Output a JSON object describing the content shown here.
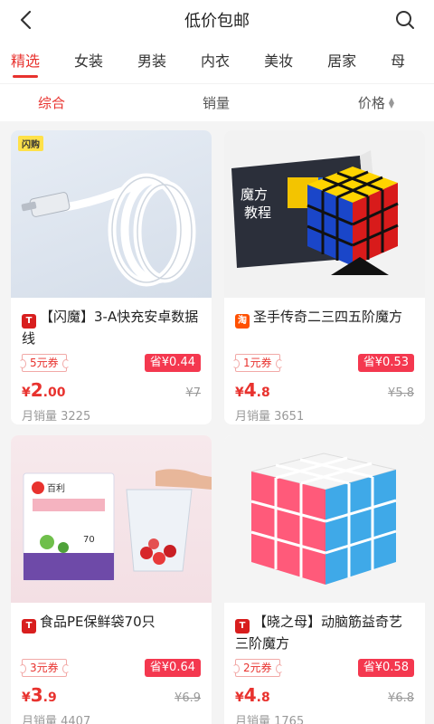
{
  "header": {
    "title": "低价包邮",
    "back_icon": "back-arrow-icon",
    "search_icon": "search-icon"
  },
  "categories": [
    "精选",
    "女装",
    "男装",
    "内衣",
    "美妆",
    "居家",
    "母"
  ],
  "sort": {
    "overall": "综合",
    "sales": "销量",
    "price": "价格"
  },
  "colors": {
    "accent": "#e8322e",
    "save_bg": "#f4384f"
  },
  "products": [
    {
      "badge": "T",
      "flash_tag": "闪购",
      "name": "【闪魔】3-A快充安卓数据线",
      "coupon": "5元券",
      "save": "省¥0.44",
      "price_int": "2",
      "price_dec": ".00",
      "currency": "¥",
      "orig_price": "¥7",
      "sales": "月销量 3225"
    },
    {
      "badge": "淘",
      "name": "圣手传奇二三四五阶魔方",
      "coupon": "1元券",
      "save": "省¥0.53",
      "price_int": "4",
      "price_dec": ".8",
      "currency": "¥",
      "orig_price": "¥5.8",
      "sales": "月销量 3651",
      "box_text_1": "魔方",
      "box_text_2": "教程"
    },
    {
      "badge": "T",
      "name": "食品PE保鲜袋70只",
      "coupon": "3元券",
      "save": "省¥0.64",
      "price_int": "3",
      "price_dec": ".9",
      "currency": "¥",
      "orig_price": "¥6.9",
      "sales": "月销量 4407",
      "box_brand": "百利",
      "box_count": "70"
    },
    {
      "badge": "T",
      "name": "【晓之母】动脑筋益奇艺三阶魔方",
      "coupon": "2元券",
      "save": "省¥0.58",
      "price_int": "4",
      "price_dec": ".8",
      "currency": "¥",
      "orig_price": "¥6.8",
      "sales": "月销量 1765"
    }
  ]
}
